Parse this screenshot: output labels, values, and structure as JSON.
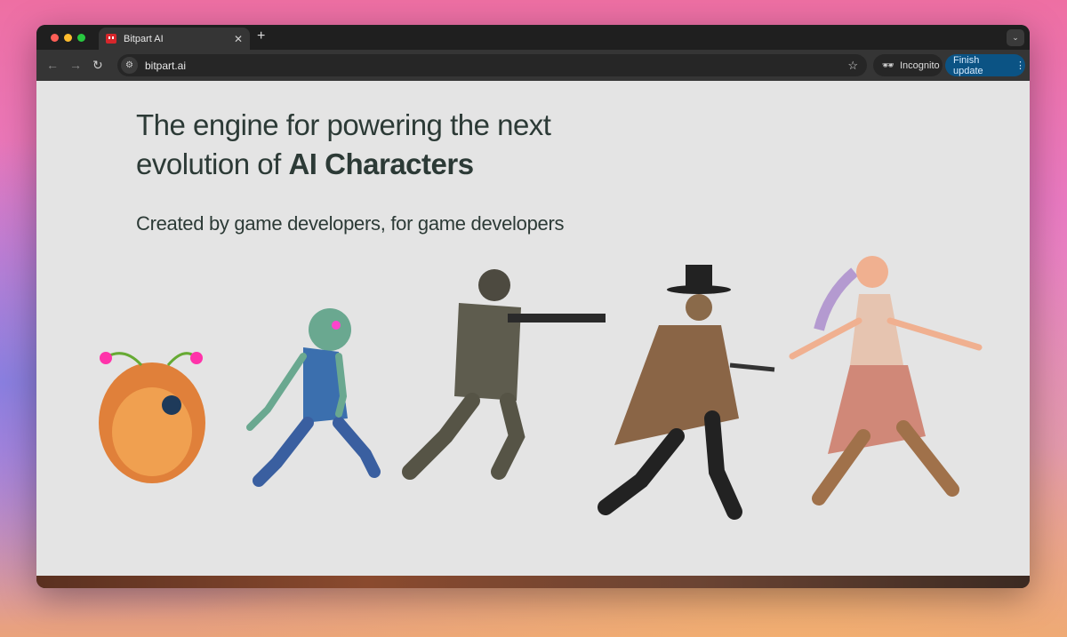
{
  "browser": {
    "tab_title": "Bitpart AI",
    "url": "bitpart.ai",
    "incognito_label": "Incognito",
    "update_label": "Finish update",
    "icons": [
      "close-icon",
      "plus-icon",
      "chevron-down-icon",
      "back-icon",
      "forward-icon",
      "reload-icon",
      "site-settings-icon",
      "star-icon",
      "incognito-icon",
      "kebab-menu-icon"
    ]
  },
  "hero": {
    "headline_start": "The engine for powering the next evolution of ",
    "headline_bold": "AI Characters",
    "subheadline": "Created by game developers, for game developers"
  },
  "characters": [
    "furry-creature",
    "zombie",
    "soldier",
    "cowboy",
    "elf-warrior"
  ]
}
